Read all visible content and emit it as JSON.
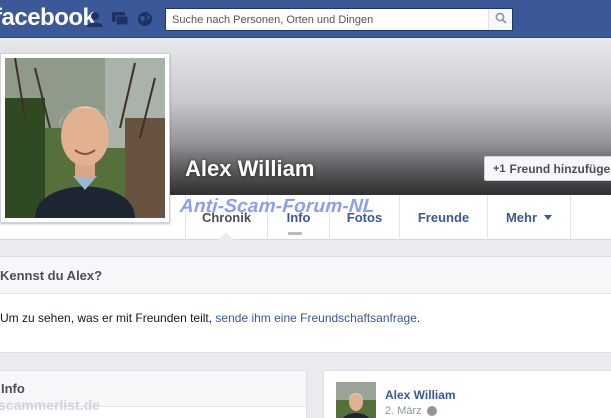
{
  "header": {
    "logo_text": "facebook",
    "search": {
      "placeholder": "Suche nach Personen, Orten und Dingen"
    },
    "icons": [
      "friends-icon",
      "messages-icon",
      "notifications-globe-icon",
      "search-icon"
    ]
  },
  "profile": {
    "name": "Alex William",
    "add_friend_label": "Freund hinzufügen",
    "add_friend_icon": "+1"
  },
  "watermark": "Anti-Scam-Forum-NL",
  "tabs": [
    {
      "label": "Chronik"
    },
    {
      "label": "Info"
    },
    {
      "label": "Fotos"
    },
    {
      "label": "Freunde"
    },
    {
      "label": "Mehr"
    }
  ],
  "know": {
    "title": "Kennst du Alex?",
    "text_before": "Um zu sehen, was er mit Freunden teilt, ",
    "link": "sende ihm eine Freundschaftsanfrage",
    "text_after": "."
  },
  "info_box": {
    "title": "Info"
  },
  "footer_watermark": "scammerlist.de",
  "post": {
    "author": "Alex William",
    "date": "2. März"
  },
  "colors": {
    "brand_blue": "#3b5998",
    "link_blue": "#365899",
    "watermark_purple": "#7a8cf0"
  }
}
